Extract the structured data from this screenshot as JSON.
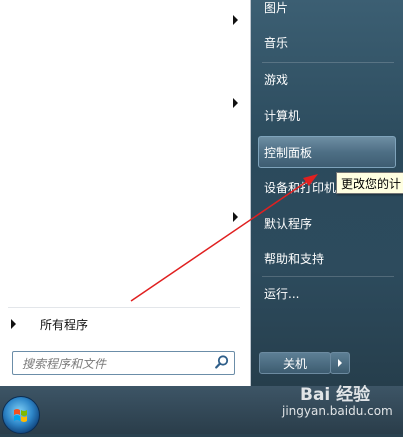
{
  "left_pane": {
    "program_rows": [
      {
        "label": "",
        "has_submenu": true
      },
      {
        "label": "",
        "has_submenu": true
      },
      {
        "label": "",
        "has_submenu": true
      }
    ],
    "all_programs_label": "所有程序",
    "search_placeholder": "搜索程序和文件"
  },
  "right_pane": {
    "items": [
      {
        "label": "图片"
      },
      {
        "label": "音乐"
      },
      {
        "label": "游戏"
      },
      {
        "label": "计算机"
      },
      {
        "label": "控制面板",
        "highlighted": true
      },
      {
        "label": "设备和打印机"
      },
      {
        "label": "默认程序"
      },
      {
        "label": "帮助和支持"
      },
      {
        "label": "运行..."
      }
    ],
    "shutdown_label": "关机"
  },
  "tooltip": {
    "text": "更改您的计"
  },
  "watermark": {
    "brand": "Bai 经验",
    "url": "jingyan.baidu.com"
  },
  "colors": {
    "annotation_arrow": "#e02020",
    "tooltip_bg": "#ffffe1"
  }
}
